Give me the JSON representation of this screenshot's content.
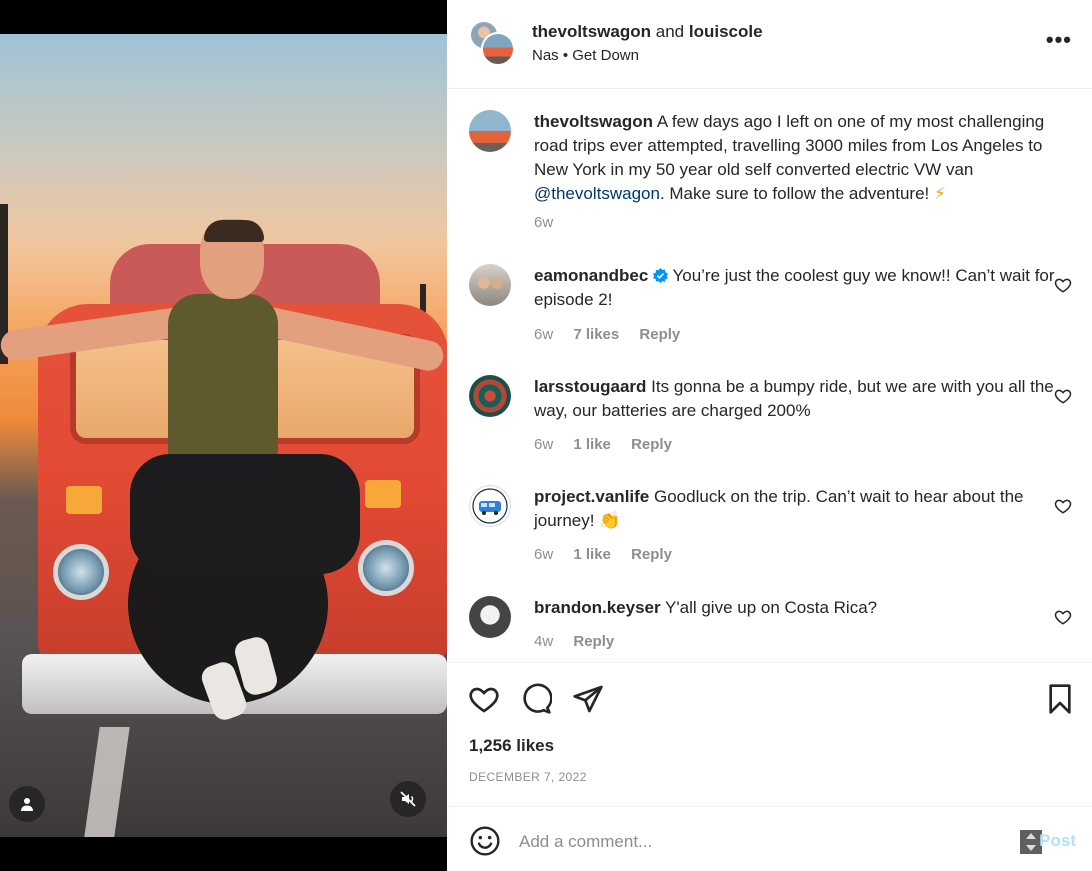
{
  "header": {
    "author": "thevoltswagon",
    "joiner": "and",
    "collaborator": "louiscole",
    "audio": "Nas • Get Down"
  },
  "caption": {
    "user": "thevoltswagon",
    "text_before": "A few days ago I left on one of my most challenging road trips ever attempted, travelling 3000 miles from Los Angeles to New York in my 50 year old self converted electric VW van",
    "mention": "@thevoltswagon",
    "text_after": ". Make sure to follow the adventure!",
    "emoji": "⚡",
    "time": "6w"
  },
  "comments": [
    {
      "user": "eamonandbec",
      "verified": true,
      "text": "You’re just the coolest guy we know!! Can’t wait for episode 2!",
      "time": "6w",
      "likes": "7 likes",
      "reply": "Reply"
    },
    {
      "user": "larsstougaard",
      "verified": false,
      "text": "Its gonna be a bumpy ride, but we are with you all the way, our batteries are charged 200%",
      "time": "6w",
      "likes": "1 like",
      "reply": "Reply"
    },
    {
      "user": "project.vanlife",
      "verified": false,
      "text": "Goodluck on the trip. Can’t wait to hear about the journey!",
      "emoji": "👏",
      "time": "6w",
      "likes": "1 like",
      "reply": "Reply"
    },
    {
      "user": "brandon.keyser",
      "verified": false,
      "text": "Y'all give up on Costa Rica?",
      "time": "4w",
      "reply": "Reply"
    }
  ],
  "footer": {
    "likes": "1,256 likes",
    "date": "DECEMBER 7, 2022",
    "comment_placeholder": "Add a comment...",
    "post_label": "Post"
  },
  "icons": {
    "more": "more-options-icon",
    "like": "heart-icon",
    "comment": "comment-bubble-icon",
    "share": "paper-plane-icon",
    "save": "bookmark-icon",
    "emoji": "emoji-smile-icon",
    "tagged": "person-tag-icon",
    "mute": "muted-speaker-icon"
  },
  "colors": {
    "verified": "#0095f6",
    "post_disabled": "#b2dffc",
    "muted_text": "#8e8e8e",
    "mention": "#00376b"
  }
}
